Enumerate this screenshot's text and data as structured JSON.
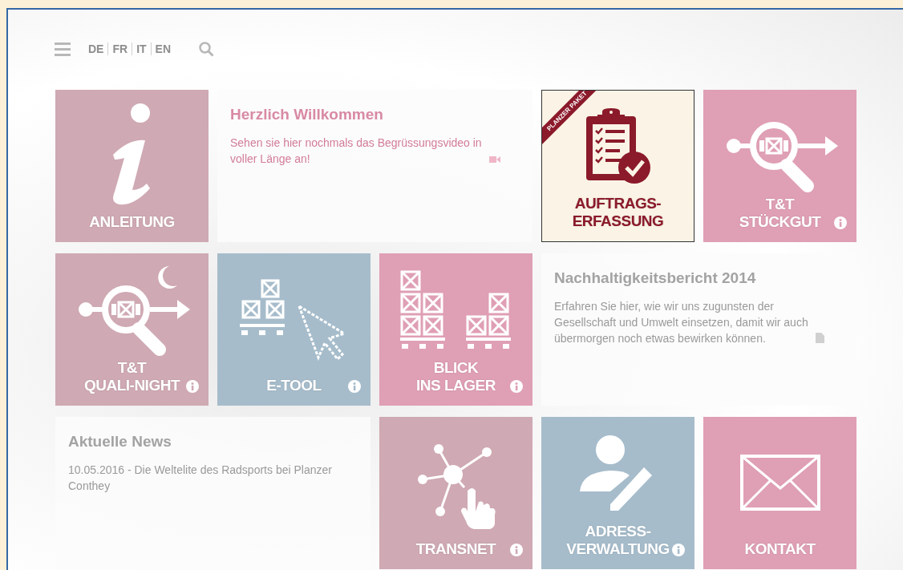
{
  "header": {
    "languages": [
      "DE",
      "FR",
      "IT",
      "EN"
    ]
  },
  "tiles": [
    {
      "kind": "icon-tile",
      "color": "#cfa9b3",
      "label_lines": [
        "ANLEITUNG"
      ],
      "info": false
    },
    {
      "kind": "text-card",
      "color": "#d98aa3",
      "title": "Herzlich Willkommen",
      "body": "Sehen sie hier nochmals das Begrüssungsvideo in voller Länge an!"
    },
    {
      "kind": "featured",
      "color": "#fbf4e6",
      "ribbon": "PLANZER PAKET",
      "label_lines": [
        "AUFTRAGS-",
        "ERFASSUNG"
      ],
      "info": false
    },
    {
      "kind": "icon-tile",
      "color": "#df9fb5",
      "label_lines": [
        "T&T",
        "STÜCKGUT"
      ],
      "info": true
    },
    {
      "kind": "icon-tile",
      "color": "#cfa9b3",
      "label_lines": [
        "T&T",
        "QUALI-NIGHT"
      ],
      "info": true
    },
    {
      "kind": "icon-tile",
      "color": "#a6bccb",
      "label_lines": [
        "E-TOOL"
      ],
      "info": true
    },
    {
      "kind": "icon-tile",
      "color": "#df9fb5",
      "label_lines": [
        "BLICK",
        "INS LAGER"
      ],
      "info": true
    },
    {
      "kind": "text-card",
      "color": "#a3a3a3",
      "title": "Nachhaltigkeitsbericht 2014",
      "body": "Erfahren Sie hier, wie wir uns zugunsten der Gesellschaft und Umwelt einsetzen, damit wir auch übermorgen noch etwas bewirken können."
    },
    {
      "kind": "text-card",
      "color": "#a3a3a3",
      "title": "Aktuelle News",
      "body": "10.05.2016 - Die Weltelite des Radsports bei Planzer Conthey"
    },
    {
      "kind": "icon-tile",
      "color": "#cfa9b3",
      "label_lines": [
        "TRANSNET"
      ],
      "info": true
    },
    {
      "kind": "icon-tile",
      "color": "#a6bccb",
      "label_lines": [
        "ADRESS-",
        "VERWALTUNG"
      ],
      "info": true
    },
    {
      "kind": "icon-tile",
      "color": "#df9fb5",
      "label_lines": [
        "KONTAKT"
      ],
      "info": false
    }
  ]
}
